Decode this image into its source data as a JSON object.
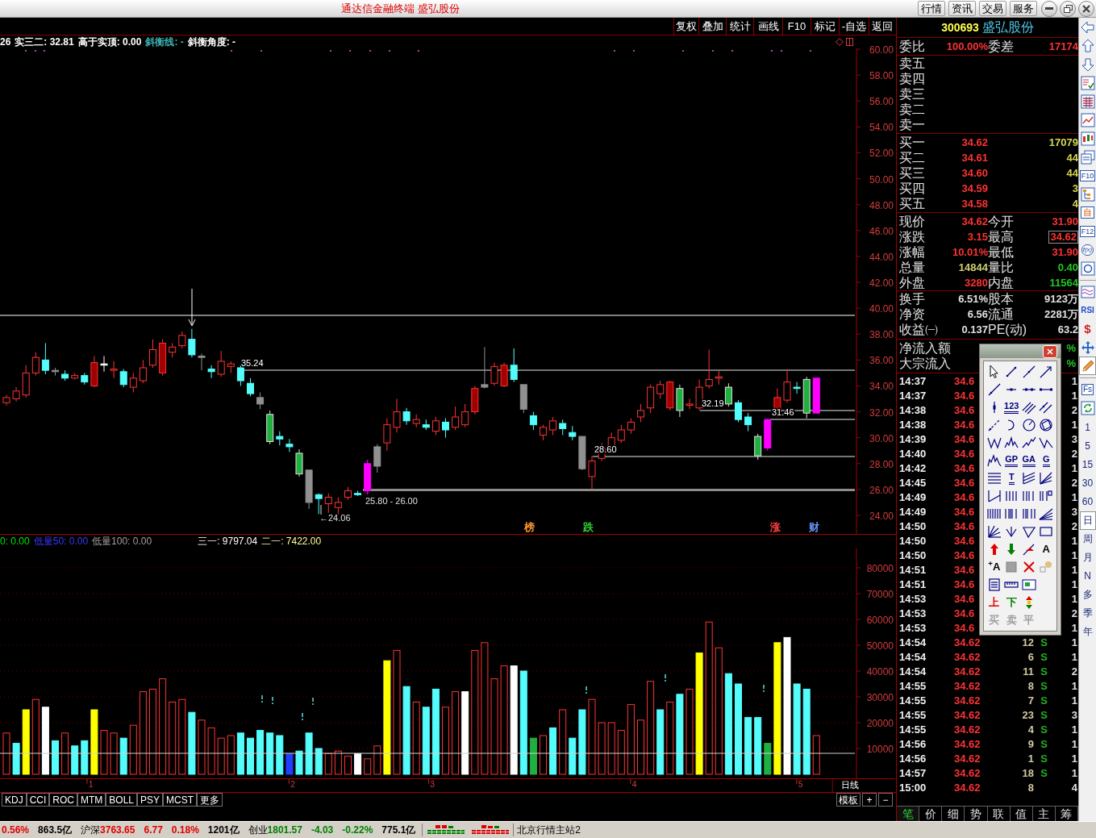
{
  "title_bar": {
    "title": "通达信金融终端 盛弘股份",
    "menu": [
      "行情",
      "资讯",
      "交易",
      "服务"
    ]
  },
  "chart_toolbar": [
    "复权",
    "叠加",
    "统计",
    "画线",
    "F10",
    "标记",
    "-自选",
    "返回"
  ],
  "indicator_header": [
    {
      "text": "26",
      "color": "#ffffff"
    },
    {
      "text": "实三二: 32.81",
      "color": "#ffffff"
    },
    {
      "text": "高于实顶: 0.00",
      "color": "#ffffff"
    },
    {
      "text": "斜衡线: -",
      "color": "#3cb4b4"
    },
    {
      "text": "斜衡角度: -",
      "color": "#ffffff"
    }
  ],
  "price_chart": {
    "axis_labels": [
      "60.00",
      "58.00",
      "56.00",
      "54.00",
      "52.00",
      "50.00",
      "48.00",
      "46.00",
      "44.00",
      "42.00",
      "40.00",
      "38.00",
      "36.00",
      "34.00",
      "32.00",
      "30.00",
      "28.00",
      "26.00",
      "24.00"
    ],
    "line_labels": [
      "35.24",
      "32.19",
      "31.46",
      "28.60"
    ],
    "range_label": "25.80 - 26.00",
    "low_label": "←24.06",
    "events": [
      {
        "label": "榜",
        "color": "#ff9933"
      },
      {
        "label": "跌",
        "color": "#33cc33"
      },
      {
        "label": "涨",
        "color": "#ff4040"
      },
      {
        "label": "财",
        "color": "#6699ff"
      }
    ]
  },
  "volume_header": [
    {
      "text": "0: 0.00",
      "color": "#00e600"
    },
    {
      "text": "低量50: 0.00",
      "color": "#3838ff"
    },
    {
      "text": "低量100: 0.00",
      "color": "#a0a0a0"
    },
    {
      "text": "三一: 9797.04",
      "color": "#ffffff"
    },
    {
      "text": "二一: 7422.00",
      "color": "#ffff99"
    }
  ],
  "volume_chart": {
    "axis_labels": [
      "80000",
      "70000",
      "60000",
      "50000",
      "40000",
      "30000",
      "20000",
      "10000"
    ]
  },
  "x_axis": {
    "labels": [
      "1",
      "2",
      "3",
      "4",
      "5"
    ],
    "period": "日线"
  },
  "indicator_tabs": [
    "KDJ",
    "CCI",
    "ROC",
    "MTM",
    "BOLL",
    "PSY",
    "MCST",
    "更多"
  ],
  "template_buttons": [
    "模板",
    "+",
    "−"
  ],
  "quote": {
    "code": "300693",
    "name": "盛弘股份",
    "order_ratio": [
      {
        "label": "委比",
        "value": "100.00%"
      },
      {
        "label": "委差",
        "value": "17174"
      }
    ],
    "asks": [
      "卖五",
      "卖四",
      "卖三",
      "卖二",
      "卖一"
    ],
    "bids": [
      {
        "label": "买一",
        "price": "34.62",
        "volume": "17079"
      },
      {
        "label": "买二",
        "price": "34.61",
        "volume": "44"
      },
      {
        "label": "买三",
        "price": "34.60",
        "volume": "44"
      },
      {
        "label": "买四",
        "price": "34.59",
        "volume": "3"
      },
      {
        "label": "买五",
        "price": "34.58",
        "volume": "4"
      }
    ],
    "stats": [
      {
        "label": "现价",
        "value": "34.62",
        "color": "#ff3232",
        "highlighted": false
      },
      {
        "label": "今开",
        "value": "31.90",
        "color": "#ff3232",
        "highlighted": false
      },
      {
        "label": "涨跌",
        "value": "3.15",
        "color": "#ff3232",
        "highlighted": false
      },
      {
        "label": "最高",
        "value": "34.62",
        "color": "#ff3232",
        "highlighted": true
      },
      {
        "label": "涨幅",
        "value": "10.01%",
        "color": "#ff3232",
        "highlighted": false
      },
      {
        "label": "最低",
        "value": "31.90",
        "color": "#ff3232",
        "highlighted": false
      },
      {
        "label": "总量",
        "value": "14844",
        "color": "#d0d070",
        "highlighted": false
      },
      {
        "label": "量比",
        "value": "0.40",
        "color": "#22c822",
        "highlighted": false
      },
      {
        "label": "外盘",
        "value": "3280",
        "color": "#ff3232",
        "highlighted": false
      },
      {
        "label": "内盘",
        "value": "11564",
        "color": "#22c822",
        "highlighted": false
      }
    ],
    "shares": [
      {
        "label": "换手",
        "value": "6.51%"
      },
      {
        "label": "股本",
        "value": "9123万"
      },
      {
        "label": "净资",
        "value": "6.56"
      },
      {
        "label": "流通",
        "value": "2281万"
      },
      {
        "label": "收益㈠",
        "value": "0.137"
      },
      {
        "label": "PE(动)",
        "value": "63.2"
      }
    ],
    "flows": [
      {
        "label": "净流入额",
        "value": "%"
      },
      {
        "label": "大宗流入",
        "value": "%"
      }
    ]
  },
  "ticks": [
    {
      "time": "14:37",
      "price": "34.6",
      "count": "1"
    },
    {
      "time": "14:37",
      "price": "34.6",
      "count": "1"
    },
    {
      "time": "14:38",
      "price": "34.6",
      "count": "2"
    },
    {
      "time": "14:38",
      "price": "34.6",
      "count": "1"
    },
    {
      "time": "14:39",
      "price": "34.6",
      "count": "3"
    },
    {
      "time": "14:40",
      "price": "34.6",
      "count": "2"
    },
    {
      "time": "14:42",
      "price": "34.6",
      "count": "1"
    },
    {
      "time": "14:45",
      "price": "34.6",
      "count": "2"
    },
    {
      "time": "14:49",
      "price": "34.6",
      "count": "1"
    },
    {
      "time": "14:49",
      "price": "34.6",
      "count": "3"
    },
    {
      "time": "14:50",
      "price": "34.6",
      "count": "2"
    },
    {
      "time": "14:50",
      "price": "34.6",
      "count": "1"
    },
    {
      "time": "14:50",
      "price": "34.6",
      "count": "1"
    },
    {
      "time": "14:51",
      "price": "34.6",
      "count": "1"
    },
    {
      "time": "14:51",
      "price": "34.6",
      "count": "1"
    },
    {
      "time": "14:53",
      "price": "34.6",
      "count": "1"
    },
    {
      "time": "14:53",
      "price": "34.6",
      "count": "2"
    },
    {
      "time": "14:53",
      "price": "34.6",
      "count": "1"
    },
    {
      "time": "14:54",
      "price": "34.62",
      "volume": "12",
      "side": "S",
      "count": "1"
    },
    {
      "time": "14:54",
      "price": "34.62",
      "volume": "6",
      "side": "S",
      "count": "1"
    },
    {
      "time": "14:54",
      "price": "34.62",
      "volume": "11",
      "side": "S",
      "count": "2"
    },
    {
      "time": "14:55",
      "price": "34.62",
      "volume": "8",
      "side": "S",
      "count": "1"
    },
    {
      "time": "14:55",
      "price": "34.62",
      "volume": "7",
      "side": "S",
      "count": "1"
    },
    {
      "time": "14:55",
      "price": "34.62",
      "volume": "23",
      "side": "S",
      "count": "3"
    },
    {
      "time": "14:55",
      "price": "34.62",
      "volume": "4",
      "side": "S",
      "count": "1"
    },
    {
      "time": "14:56",
      "price": "34.62",
      "volume": "9",
      "side": "S",
      "count": "1"
    },
    {
      "time": "14:56",
      "price": "34.62",
      "volume": "1",
      "side": "S",
      "count": "1"
    },
    {
      "time": "14:57",
      "price": "34.62",
      "volume": "18",
      "side": "S",
      "count": "1"
    },
    {
      "time": "15:00",
      "price": "34.62",
      "volume": "8",
      "count": "4"
    }
  ],
  "panel_tabs": [
    {
      "label": "笔",
      "selected": true
    },
    {
      "label": "价",
      "selected": false
    },
    {
      "label": "细",
      "selected": false
    },
    {
      "label": "势",
      "selected": false
    },
    {
      "label": "联",
      "selected": false
    },
    {
      "label": "值",
      "selected": false
    },
    {
      "label": "主",
      "selected": false
    },
    {
      "label": "筹",
      "selected": false
    }
  ],
  "drawing_palette": {
    "text_tools": [
      {
        "label": "123",
        "color": "#000080"
      },
      {
        "label": "GP",
        "color": "#000080"
      },
      {
        "label": "GA",
        "color": "#000080"
      },
      {
        "label": "G",
        "color": "#000080"
      },
      {
        "label": "T",
        "color": "#000080"
      },
      {
        "label": "A",
        "color": "#000000"
      },
      {
        "label": "$^{+}$A",
        "color": "#000000"
      },
      {
        "label": "上",
        "color": "#e00000"
      },
      {
        "label": "下",
        "color": "#008000"
      },
      {
        "label": "买",
        "color": "#a0a0a0"
      },
      {
        "label": "卖",
        "color": "#a0a0a0"
      },
      {
        "label": "平",
        "color": "#a0a0a0"
      }
    ]
  },
  "side_toolbar": {
    "labels": [
      "F10",
      "自",
      "F12",
      "f(x)",
      "RSI",
      "$",
      "Fs"
    ],
    "draw_mode": true,
    "periods": [
      {
        "label": "1",
        "selected": false
      },
      {
        "label": "5",
        "selected": false
      },
      {
        "label": "15",
        "selected": false
      },
      {
        "label": "30",
        "selected": false
      },
      {
        "label": "60",
        "selected": false
      },
      {
        "label": "日",
        "selected": true
      },
      {
        "label": "周",
        "selected": false
      },
      {
        "label": "月",
        "selected": false
      },
      {
        "label": "N",
        "selected": false
      },
      {
        "label": "多",
        "selected": false
      },
      {
        "label": "季",
        "selected": false
      },
      {
        "label": "年",
        "selected": false
      }
    ]
  },
  "status_bar": {
    "items": [
      {
        "value": "0.56%",
        "color": "#e00000"
      },
      {
        "value": "863.5亿",
        "color": "#000000"
      },
      {
        "label": "沪深",
        "value": "3763.65",
        "color": "#e00000"
      },
      {
        "value": "6.77",
        "color": "#e00000"
      },
      {
        "value": "0.18%",
        "color": "#e00000"
      },
      {
        "value": "1201亿",
        "color": "#000000"
      },
      {
        "label": "创业",
        "value": "1801.57",
        "color": "#008000"
      },
      {
        "value": "-4.03",
        "color": "#008000"
      },
      {
        "value": "-0.22%",
        "color": "#008000"
      },
      {
        "value": "775.1亿",
        "color": "#000000"
      }
    ],
    "server": "北京行情主站2"
  }
}
